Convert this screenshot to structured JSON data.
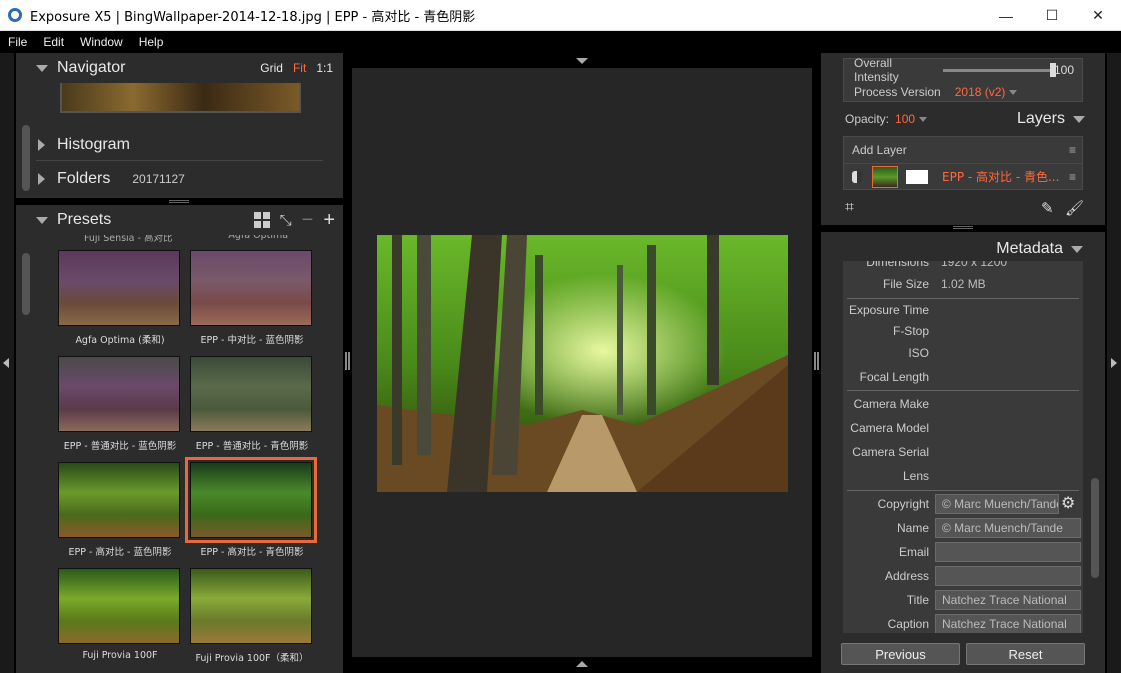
{
  "window": {
    "title": "Exposure X5 | BingWallpaper-2014-12-18.jpg | EPP - 高对比 - 青色阴影",
    "controls": [
      "—",
      "☐",
      "✕"
    ]
  },
  "menu": [
    "File",
    "Edit",
    "Window",
    "Help"
  ],
  "navigator": {
    "title": "Navigator",
    "options": [
      "Grid",
      "Fit",
      "1:1"
    ],
    "active_option": "Fit"
  },
  "histogram": {
    "title": "Histogram"
  },
  "folders": {
    "title": "Folders",
    "value": "20171127"
  },
  "presets": {
    "title": "Presets",
    "partial_top": [
      "Fuji Sensia - 高对比",
      "Agfa Optima"
    ],
    "items": [
      {
        "label": "Agfa Optima (柔和)"
      },
      {
        "label": "EPP - 中对比 - 蓝色阴影"
      },
      {
        "label": "EPP - 普通对比 - 蓝色阴影"
      },
      {
        "label": "EPP - 普通对比 - 青色阴影"
      },
      {
        "label": "EPP - 高对比 - 蓝色阴影"
      },
      {
        "label": "EPP - 高对比 - 青色阴影",
        "selected": true
      },
      {
        "label": "Fuji Provia 100F"
      },
      {
        "label": "Fuji Provia 100F（柔和）"
      }
    ]
  },
  "adjust": {
    "overall_intensity_label": "Overall Intensity",
    "overall_intensity_value": "100",
    "process_version_label": "Process Version",
    "process_version_value": "2018 (v2)"
  },
  "layers": {
    "opacity_label": "Opacity:",
    "opacity_value": "100",
    "title": "Layers",
    "add_layer": "Add Layer",
    "layer_name": "EPP - 高对比 - 青色..."
  },
  "metadata": {
    "title": "Metadata",
    "rows": [
      {
        "key": "Dimensions",
        "value": "1920 x 1200"
      },
      {
        "key": "File Size",
        "value": "1.02 MB"
      },
      {
        "key": "Exposure Time",
        "value": ""
      },
      {
        "key": "F-Stop",
        "value": ""
      },
      {
        "key": "ISO",
        "value": ""
      },
      {
        "key": "Focal Length",
        "value": ""
      },
      {
        "key": "Camera Make",
        "value": ""
      },
      {
        "key": "Camera Model",
        "value": ""
      },
      {
        "key": "Camera Serial",
        "value": ""
      },
      {
        "key": "Lens",
        "value": ""
      },
      {
        "key": "Copyright",
        "value": "© Marc Muench/Tande"
      },
      {
        "key": "Name",
        "value": "© Marc Muench/Tande"
      },
      {
        "key": "Email",
        "value": ""
      },
      {
        "key": "Address",
        "value": ""
      },
      {
        "key": "Title",
        "value": "Natchez Trace National"
      },
      {
        "key": "Caption",
        "value": "Natchez Trace National"
      }
    ]
  },
  "buttons": {
    "previous": "Previous",
    "reset": "Reset"
  },
  "colors": {
    "accent": "#ff6a3c",
    "panel": "#2c2c2c",
    "selection": "#e86a3a"
  }
}
